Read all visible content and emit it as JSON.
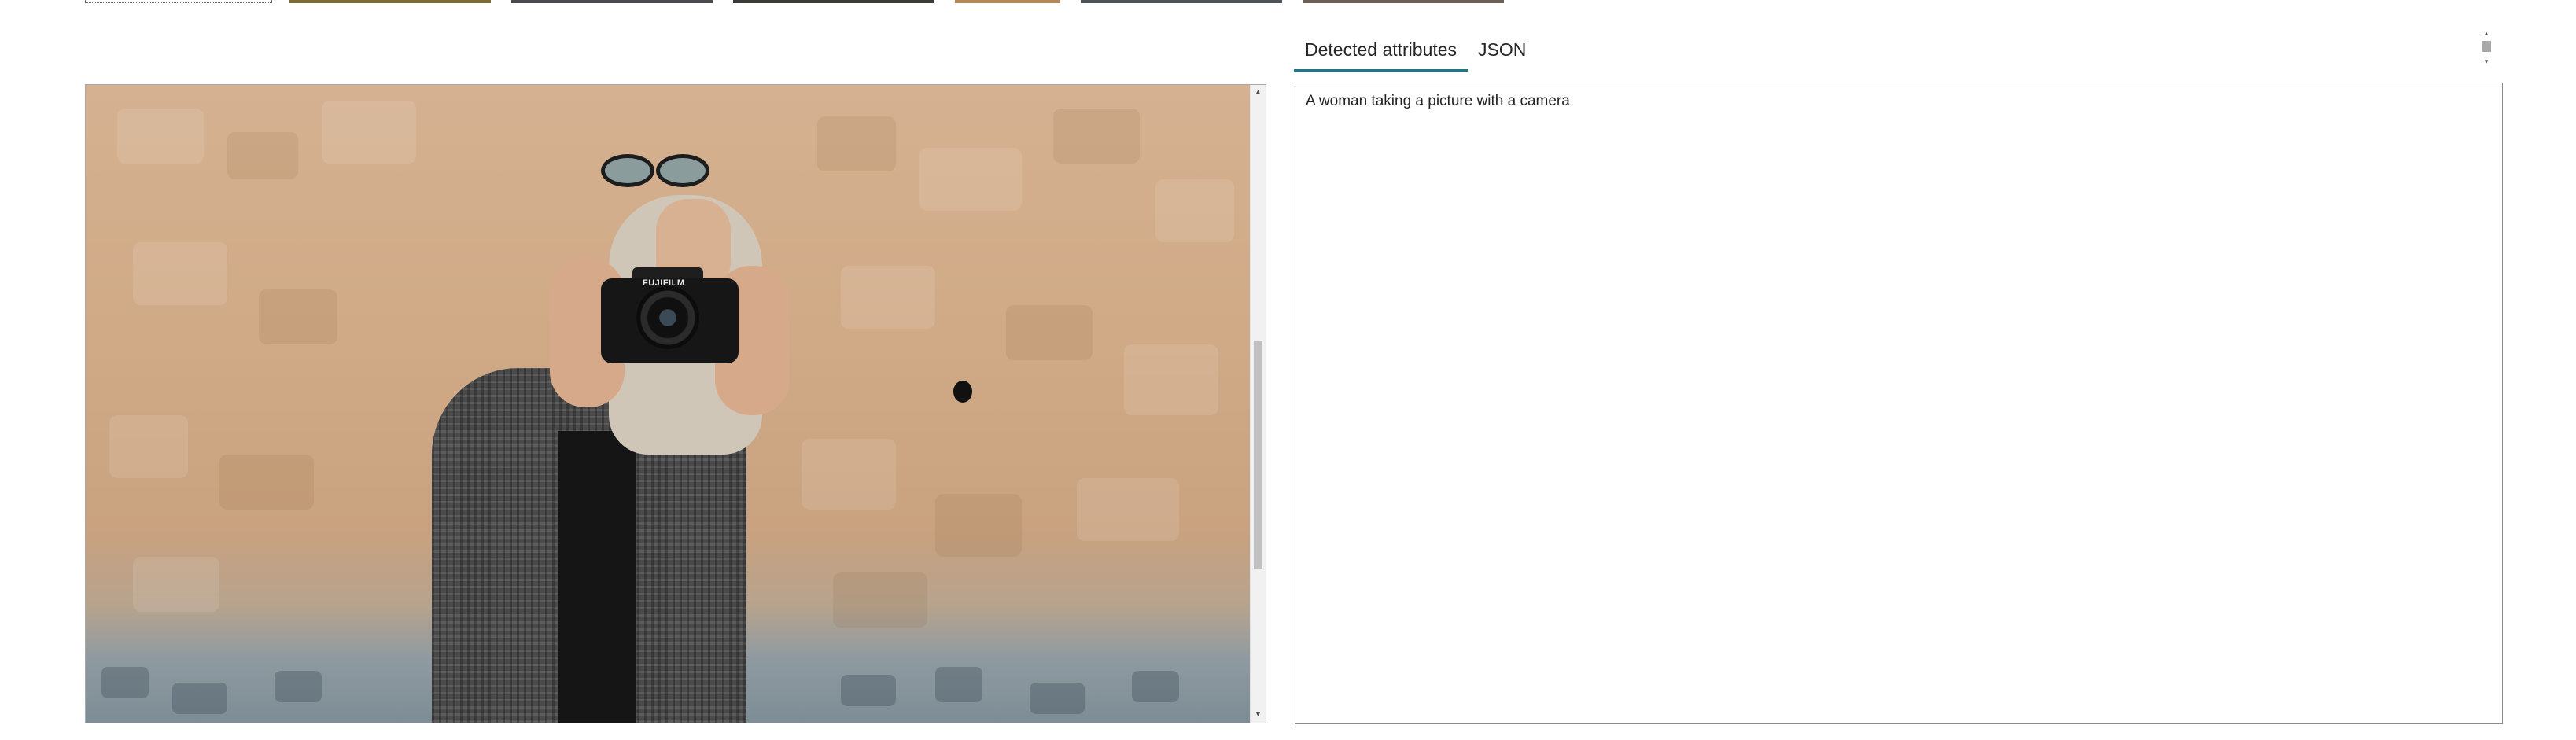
{
  "thumbnails": {
    "items": [
      {
        "selected": true,
        "color": "#ffffff"
      },
      {
        "selected": false,
        "color": "#7d6a3a"
      },
      {
        "selected": false,
        "color": "#4b4b52"
      },
      {
        "selected": false,
        "color": "#3b3a36"
      },
      {
        "selected": false,
        "color": "#b08a58"
      },
      {
        "selected": false,
        "color": "#505459"
      },
      {
        "selected": false,
        "color": "#6a5f57"
      }
    ]
  },
  "viewer": {
    "image_label": "FUJIFILM",
    "scroll_up_icon": "triangle-up-icon",
    "scroll_down_icon": "triangle-down-icon",
    "scroll_up_glyph": "▲",
    "scroll_down_glyph": "▼"
  },
  "panel": {
    "tabs": [
      {
        "label": "Detected attributes",
        "active": true
      },
      {
        "label": "JSON",
        "active": false
      }
    ],
    "mini_scroll_up_glyph": "▴",
    "mini_scroll_down_glyph": "▾",
    "result_text": "A woman taking a picture with a camera"
  },
  "colors": {
    "accent": "#1a7a8c",
    "border": "#8a8a8a",
    "scrollbar_thumb": "#c1c1c1"
  }
}
